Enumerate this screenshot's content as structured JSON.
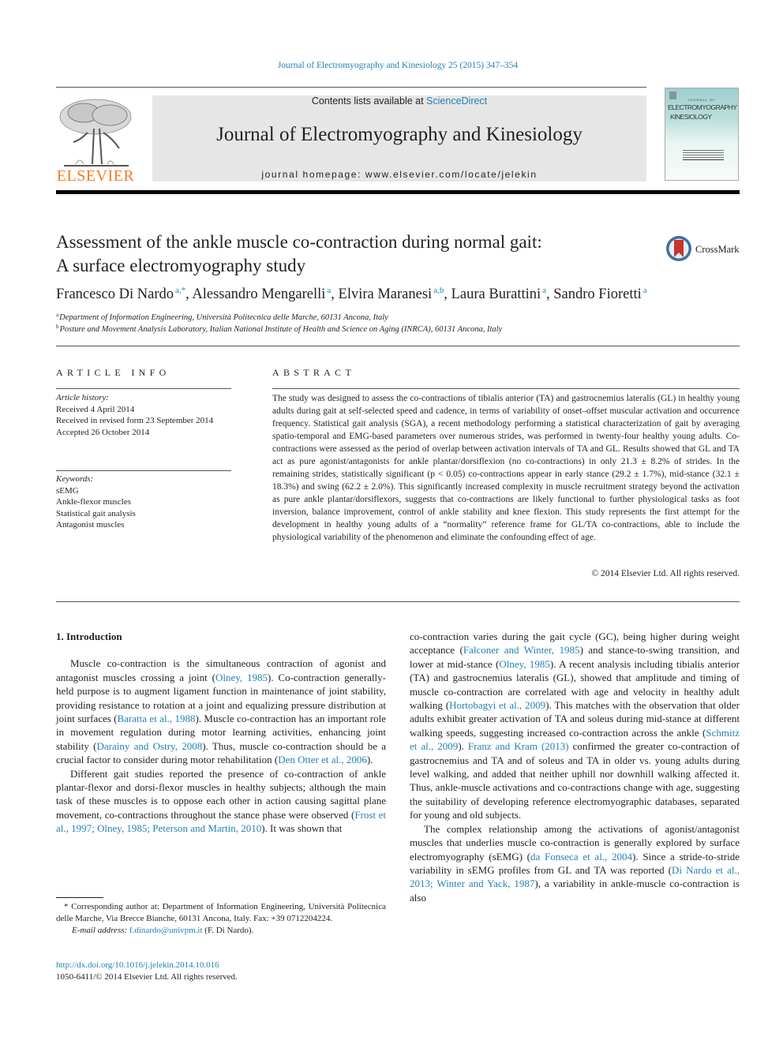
{
  "journal_reference": "Journal of Electromyography and Kinesiology 25 (2015) 347–354",
  "masthead": {
    "publisher_logo_label": "ELSEVIER",
    "contents_prefix": "Contents lists available at ",
    "contents_link": "ScienceDirect",
    "journal_title": "Journal of Electromyography and Kinesiology",
    "homepage": "journal homepage: www.elsevier.com/locate/jelekin",
    "cover": {
      "small_line": "JOURNAL OF",
      "title_line1": "ELECTROMYOGRAPHY",
      "title_line2": "KINESIOLOGY"
    }
  },
  "article": {
    "title_line1": "Assessment of the ankle muscle co-contraction during normal gait:",
    "title_line2": "A surface electromyography study",
    "crossmark_label": "CrossMark",
    "authors": [
      {
        "name": "Francesco Di Nardo",
        "marks": "a,*",
        "sep": ", "
      },
      {
        "name": "Alessandro Mengarelli",
        "marks": "a",
        "sep": ", "
      },
      {
        "name": "Elvira Maranesi",
        "marks": "a,b",
        "sep": ", "
      },
      {
        "name": "Laura Burattini",
        "marks": "a",
        "sep": ", "
      },
      {
        "name": "Sandro Fioretti",
        "marks": "a",
        "sep": ""
      }
    ],
    "affiliations": [
      {
        "mark": "a",
        "text": "Department of Information Engineering, Università Politecnica delle Marche, 60131 Ancona, Italy"
      },
      {
        "mark": "b",
        "text": "Posture and Movement Analysis Laboratory, Italian National Institute of Health and Science on Aging (INRCA), 60131 Ancona, Italy"
      }
    ]
  },
  "article_info": {
    "heading": "ARTICLE INFO",
    "history_label": "Article history:",
    "history": [
      "Received 4 April 2014",
      "Received in revised form 23 September 2014",
      "Accepted 26 October 2014"
    ],
    "keywords_label": "Keywords:",
    "keywords": [
      "sEMG",
      "Ankle-flexor muscles",
      "Statistical gait analysis",
      "Antagonist muscles"
    ]
  },
  "abstract": {
    "heading": "ABSTRACT",
    "text": "The study was designed to assess the co-contractions of tibialis anterior (TA) and gastrocnemius lateralis (GL) in healthy young adults during gait at self-selected speed and cadence, in terms of variability of onset–offset muscular activation and occurrence frequency. Statistical gait analysis (SGA), a recent methodology performing a statistical characterization of gait by averaging spatio-temporal and EMG-based parameters over numerous strides, was performed in twenty-four healthy young adults. Co-contractions were assessed as the period of overlap between activation intervals of TA and GL. Results showed that GL and TA act as pure agonist/antagonists for ankle plantar/dorsiflexion (no co-contractions) in only 21.3 ± 8.2% of strides. In the remaining strides, statistically significant (p < 0.05) co-contractions appear in early stance (29.2 ± 1.7%), mid-stance (32.1 ± 18.3%) and swing (62.2 ± 2.0%). This significantly increased complexity in muscle recruitment strategy beyond the activation as pure ankle plantar/dorsiflexors, suggests that co-contractions are likely functional to further physiological tasks as foot inversion, balance improvement, control of ankle stability and knee flexion. This study represents the first attempt for the development in healthy young adults of a “normality” reference frame for GL/TA co-contractions, able to include the physiological variability of the phenomenon and eliminate the confounding effect of age.",
    "copyright": "© 2014 Elsevier Ltd. All rights reserved."
  },
  "body": {
    "section_heading": "1. Introduction",
    "left_paragraphs": [
      [
        {
          "t": "Muscle co-contraction is the simultaneous contraction of agonist and antagonist muscles crossing a joint ("
        },
        {
          "t": "Olney, 1985",
          "link": true
        },
        {
          "t": "). Co-contraction generally-held purpose is to augment ligament function in maintenance of joint stability, providing resistance to rotation at a joint and equalizing pressure distribution at joint surfaces ("
        },
        {
          "t": "Baratta et al., 1988",
          "link": true
        },
        {
          "t": "). Muscle co-contraction has an important role in movement regulation during motor learning activities, enhancing joint stability ("
        },
        {
          "t": "Darainy and Ostry, 2008",
          "link": true
        },
        {
          "t": "). Thus, muscle co-contraction should be a crucial factor to consider during motor rehabilitation ("
        },
        {
          "t": "Den Otter et al., 2006",
          "link": true
        },
        {
          "t": ")."
        }
      ],
      [
        {
          "t": "Different gait studies reported the presence of co-contraction of ankle plantar-flexor and dorsi-flexor muscles in healthy subjects; although the main task of these muscles is to oppose each other in action causing sagittal plane movement, co-contractions throughout the stance phase were observed ("
        },
        {
          "t": "Frost et al., 1997; Olney, 1985; Peterson and Martin, 2010",
          "link": true
        },
        {
          "t": "). It was shown that"
        }
      ]
    ],
    "right_paragraphs": [
      [
        {
          "t": "co-contraction varies during the gait cycle (GC), being higher during weight acceptance ("
        },
        {
          "t": "Falconer and Winter, 1985",
          "link": true
        },
        {
          "t": ") and stance-to-swing transition, and lower at mid-stance ("
        },
        {
          "t": "Olney, 1985",
          "link": true
        },
        {
          "t": "). A recent analysis including tibialis anterior (TA) and gastrocnemius lateralis (GL), showed that amplitude and timing of muscle co-contraction are correlated with age and velocity in healthy adult walking ("
        },
        {
          "t": "Hortobagyi et al., 2009",
          "link": true
        },
        {
          "t": "). This matches with the observation that older adults exhibit greater activation of TA and soleus during mid-stance at different walking speeds, suggesting increased co-contraction across the ankle ("
        },
        {
          "t": "Schmitz et al., 2009",
          "link": true
        },
        {
          "t": "). "
        },
        {
          "t": "Franz and Kram (2013)",
          "link": true
        },
        {
          "t": " confirmed the greater co-contraction of gastrocnemius and TA and of soleus and TA in older vs. young adults during level walking, and added that neither uphill nor downhill walking affected it. Thus, ankle-muscle activations and co-contractions change with age, suggesting the suitability of developing reference electromyographic databases, separated for young and old subjects."
        }
      ],
      [
        {
          "t": "The complex relationship among the activations of agonist/antagonist muscles that underlies muscle co-contraction is generally explored by surface electromyography (sEMG) ("
        },
        {
          "t": "da Fonseca et al., 2004",
          "link": true
        },
        {
          "t": "). Since a stride-to-stride variability in sEMG profiles from GL and TA was reported ("
        },
        {
          "t": "Di Nardo et al., 2013; Winter and Yack, 1987",
          "link": true
        },
        {
          "t": "), a variability in ankle-muscle co-contraction is also"
        }
      ]
    ]
  },
  "footnote": {
    "text": "* Corresponding author at: Department of Information Engineering, Università Politecnica delle Marche, Via Brecce Bianche, 60131 Ancona, Italy. Fax: +39 0712204224.",
    "email_label": "E-mail address: ",
    "email": "f.dinardo@univpm.it",
    "email_suffix": " (F. Di Nardo)."
  },
  "doi": {
    "link": "http://dx.doi.org/10.1016/j.jelekin.2014.10.016",
    "issn_line": "1050-6411/© 2014 Elsevier Ltd. All rights reserved."
  },
  "colors": {
    "link": "#2581b3",
    "elsevier_orange": "#f47b20",
    "masthead_bg": "#e6e6e6"
  }
}
